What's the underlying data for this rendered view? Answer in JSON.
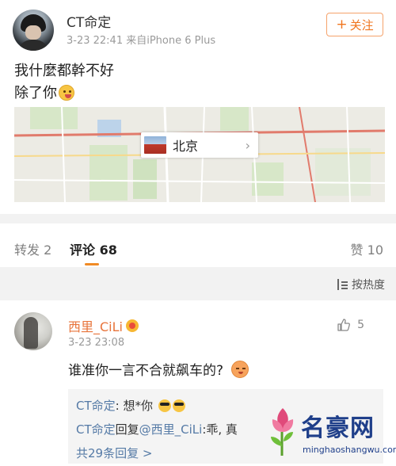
{
  "post": {
    "username": "CT命定",
    "meta": "3-23 22:41  来自iPhone 6 Plus",
    "follow_label": "关注",
    "text_line1": "我什麼都幹不好",
    "text_line2": "除了你",
    "location": {
      "name": "北京"
    }
  },
  "tabs": {
    "reposts": "转发 2",
    "comments": "评论 68",
    "likes": "赞 10"
  },
  "sort": {
    "label": "按热度"
  },
  "comment": {
    "username": "西里_CiLi",
    "time": "3-23 23:08",
    "like_count": "5",
    "text": "谁准你一言不合就飙车的?",
    "replies": {
      "r1_user": "CT命定",
      "r1_text": ": 想*你",
      "r2_user": "CT命定",
      "r2_mid": "回复",
      "r2_target": "@西里_CiLi",
      "r2_text": ":乖, 真",
      "more": "共29条回复 >"
    }
  },
  "watermark": {
    "title": "名豪网",
    "sub": "minghaoshangwu.com"
  },
  "colors": {
    "accent": "#f08a24",
    "link": "#557aa6",
    "username_comment": "#e8743b"
  }
}
